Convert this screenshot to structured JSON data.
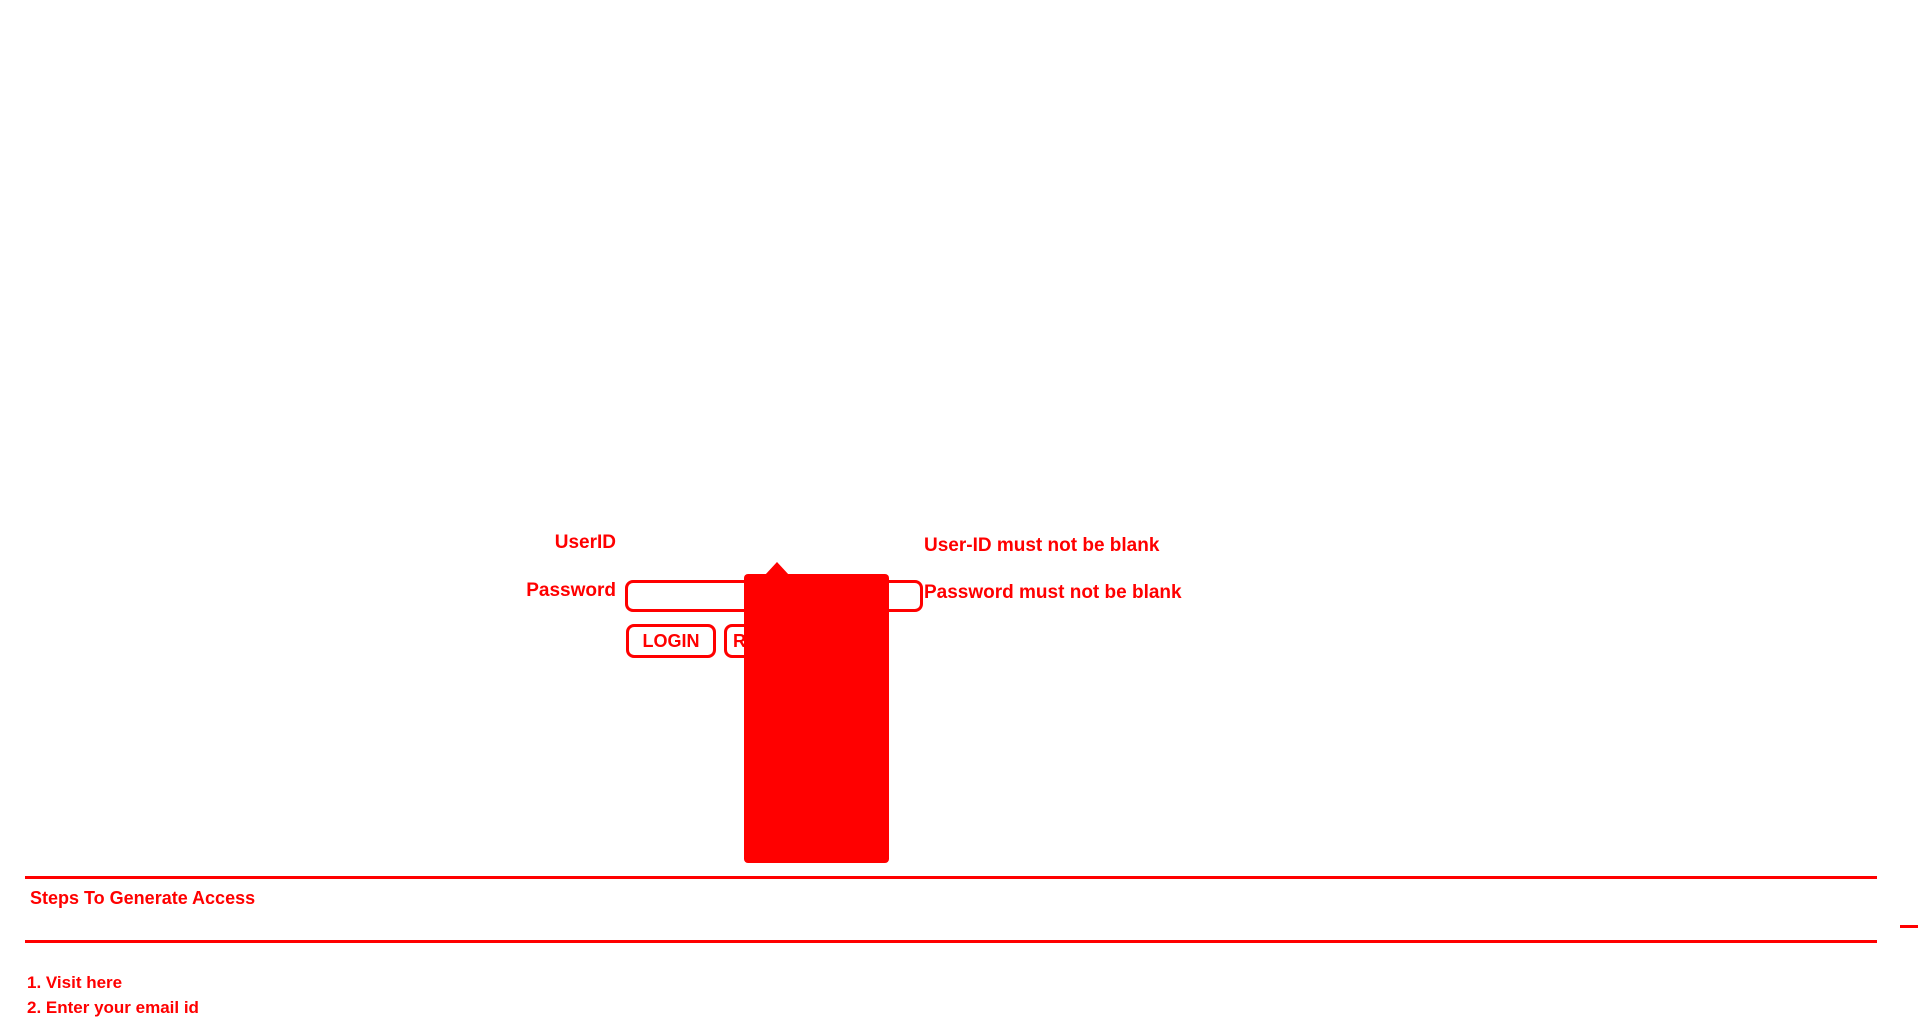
{
  "login_form": {
    "userid_label": "UserID",
    "password_label": "Password",
    "userid_value": "",
    "password_value": "",
    "userid_error": "User-ID must not be blank",
    "password_error": "Password must not be blank",
    "login_button": "LOGIN",
    "reset_button": "R"
  },
  "steps_section": {
    "title": "Steps To Generate Access",
    "steps": [
      {
        "prefix": "1. Visit ",
        "link": "here"
      },
      {
        "prefix": "2. Enter your email id",
        "link": ""
      }
    ]
  },
  "colors": {
    "primary": "#ff0000",
    "background": "#ffffff"
  }
}
